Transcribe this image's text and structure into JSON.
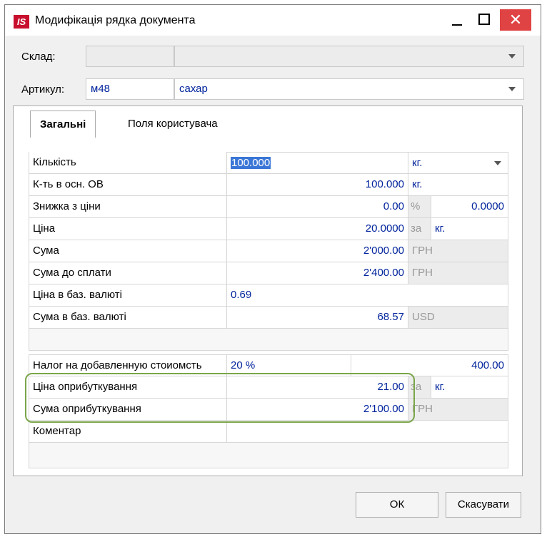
{
  "window": {
    "title": "Модифікація рядка документа",
    "app_icon_text": "IS",
    "close_glyph": "✕"
  },
  "header": {
    "sklad_label": "Склад:",
    "sklad_code": "",
    "sklad_name": "",
    "artikul_label": "Артикул:",
    "artikul_code": "м48",
    "artikul_name": "сахар"
  },
  "tabs": [
    {
      "label": "Загальні",
      "active": true
    },
    {
      "label": "Поля користувача",
      "active": false
    }
  ],
  "grid": {
    "kilkist": {
      "label": "Кількість",
      "value": "100.000",
      "unit": "кг."
    },
    "kt_osn": {
      "label": "К-ть в осн. ОВ",
      "value": "100.000",
      "unit": "кг."
    },
    "znyzhka": {
      "label": "Знижка з ціни",
      "value": "0.00",
      "unit": "%",
      "extra": "0.0000"
    },
    "tsina": {
      "label": "Ціна",
      "value": "20.0000",
      "za": "за",
      "unit": "кг."
    },
    "suma": {
      "label": "Сума",
      "value": "2'000.00",
      "currency": "ГРН"
    },
    "suma_do_splaty": {
      "label": "Сума до сплати",
      "value": "2'400.00",
      "currency": "ГРН"
    },
    "tsina_baz": {
      "label": "Ціна в баз. валюті",
      "value": "0.69"
    },
    "suma_baz": {
      "label": "Сума в баз. валюті",
      "value": "68.57",
      "currency": "USD"
    },
    "nalog": {
      "label": "Налог на добавленную стоиомсть",
      "rate": "20 %",
      "amount": "400.00"
    },
    "tsina_opryb": {
      "label": "Ціна оприбуткування",
      "value": "21.00",
      "za": "за",
      "unit": "кг."
    },
    "suma_opryb": {
      "label": "Сума оприбуткування",
      "value": "2'100.00",
      "currency": "ГРН"
    },
    "komentar": {
      "label": "Коментар",
      "value": ""
    }
  },
  "buttons": {
    "ok": "ОК",
    "cancel": "Скасувати"
  },
  "colors": {
    "accent": "#3a76d6",
    "value_text": "#00239c",
    "highlight": "#7aa64b",
    "close": "#e04343"
  }
}
